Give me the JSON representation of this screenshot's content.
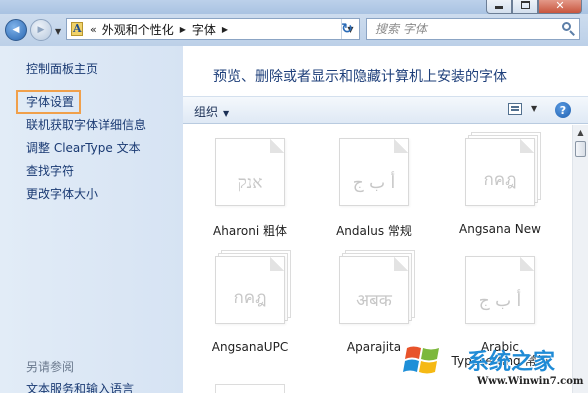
{
  "window": {
    "controls": {
      "minimize_icon": "minimize-icon",
      "maximize_icon": "maximize-icon",
      "close_icon": "close-icon",
      "close_glyph": "✕"
    }
  },
  "navigation": {
    "back_glyph": "◀",
    "forward_glyph": "▶",
    "dropdown_glyph": "▼"
  },
  "address": {
    "overflow": "«",
    "breadcrumbs": [
      "外观和个性化",
      "字体"
    ],
    "separator_glyph": "▶",
    "dropdown_glyph": "▼",
    "refresh_glyph": "↻"
  },
  "search": {
    "placeholder": "搜索 字体"
  },
  "sidebar": {
    "items": [
      {
        "label": "控制面板主页"
      },
      {
        "label": "字体设置",
        "highlighted": true
      },
      {
        "label": "联机获取字体详细信息"
      },
      {
        "label": "调整 ClearType 文本"
      },
      {
        "label": "查找字符"
      },
      {
        "label": "更改字体大小"
      }
    ],
    "see_also_heading": "另请参阅",
    "see_also_items": [
      {
        "label": "文本服务和输入语言"
      }
    ]
  },
  "main": {
    "title": "预览、删除或者显示和隐藏计算机上安装的字体",
    "toolbar": {
      "organize_label": "组织",
      "organize_arrow": "▼",
      "view_drop_glyph": "▼",
      "help_glyph": "?"
    },
    "scroll_up_glyph": "▲",
    "fonts": [
      {
        "name": "Aharoni 粗体",
        "sample": "אנק",
        "stacked": false
      },
      {
        "name": "Andalus 常规",
        "sample": "أ ب ج",
        "stacked": false
      },
      {
        "name": "Angsana New",
        "sample": "กคฎ",
        "stacked": true
      },
      {
        "name": "AngsanaUPC",
        "sample": "กคฎ",
        "stacked": true
      },
      {
        "name": "Aparajita",
        "sample": "अबक",
        "stacked": true
      },
      {
        "name": "Arabic Typesetting 常规",
        "sample": "أ ب ج",
        "stacked": false
      }
    ]
  },
  "watermark": {
    "logo_icon": "windows-flag-icon",
    "text": "系统之家",
    "url": "Www.Winwin7.com"
  }
}
